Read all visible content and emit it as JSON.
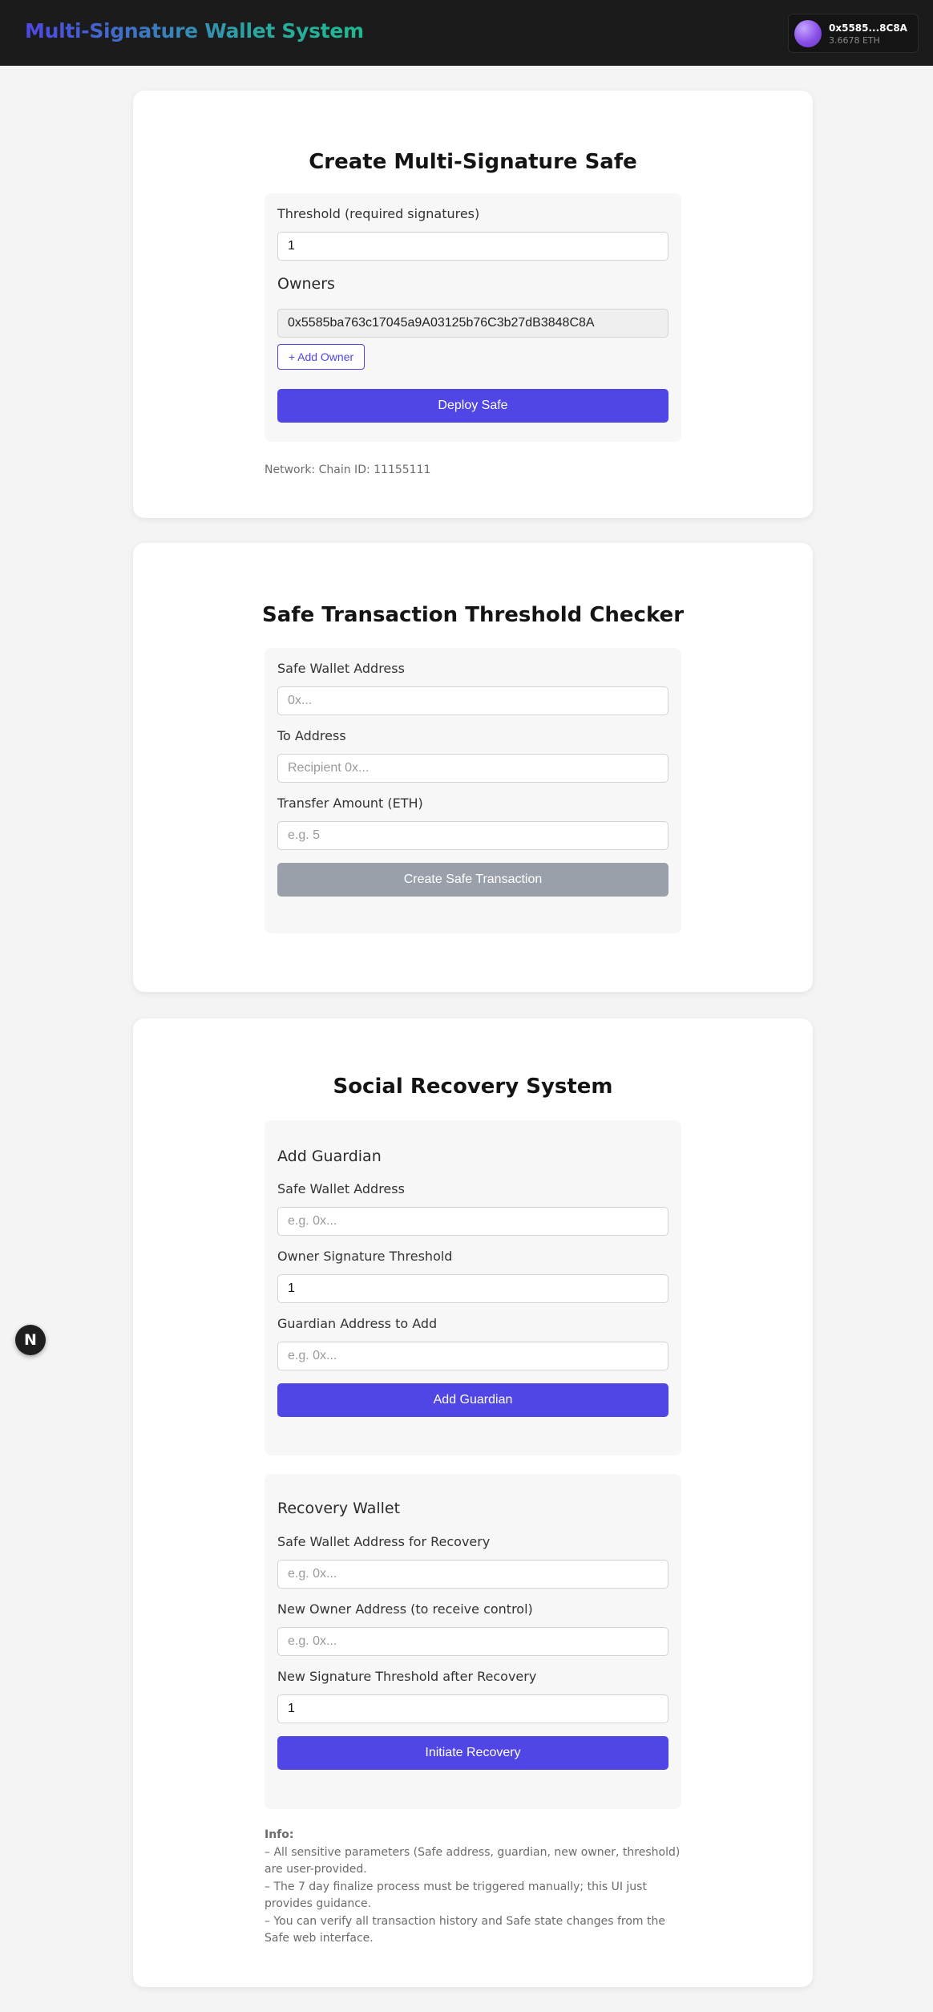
{
  "header": {
    "app_title": "Multi-Signature Wallet System",
    "wallet": {
      "address": "0x5585...8C8A",
      "balance": "3.6678 ETH"
    }
  },
  "create_safe": {
    "title": "Create Multi-Signature Safe",
    "threshold_label": "Threshold (required signatures)",
    "threshold_value": "1",
    "owners_heading": "Owners",
    "owners": [
      "0x5585ba763c17045a9A03125b76C3b27dB3848C8A"
    ],
    "add_owner_label": "+ Add Owner",
    "deploy_label": "Deploy Safe",
    "network_text": "Network: Chain ID: 11155111"
  },
  "threshold_checker": {
    "title": "Safe Transaction Threshold Checker",
    "safe_address_label": "Safe Wallet Address",
    "safe_address_placeholder": "0x...",
    "to_address_label": "To Address",
    "to_address_placeholder": "Recipient 0x...",
    "amount_label": "Transfer Amount (ETH)",
    "amount_placeholder": "e.g. 5",
    "create_tx_label": "Create Safe Transaction"
  },
  "social_recovery": {
    "title": "Social Recovery System",
    "add_guardian": {
      "heading": "Add Guardian",
      "safe_address_label": "Safe Wallet Address",
      "safe_address_placeholder": "e.g. 0x...",
      "threshold_label": "Owner Signature Threshold",
      "threshold_value": "1",
      "guardian_label": "Guardian Address to Add",
      "guardian_placeholder": "e.g. 0x...",
      "button_label": "Add Guardian"
    },
    "recovery": {
      "heading": "Recovery Wallet",
      "safe_address_label": "Safe Wallet Address for Recovery",
      "safe_address_placeholder": "e.g. 0x...",
      "new_owner_label": "New Owner Address (to receive control)",
      "new_owner_placeholder": "e.g. 0x...",
      "new_threshold_label": "New Signature Threshold after Recovery",
      "new_threshold_value": "1",
      "button_label": "Initiate Recovery"
    },
    "info": {
      "heading": "Info:",
      "lines": [
        "– All sensitive parameters (Safe address, guardian, new owner, threshold) are user-provided.",
        "– The 7 day finalize process must be triggered manually; this UI just provides guidance.",
        "– You can verify all transaction history and Safe state changes from the Safe web interface."
      ]
    }
  },
  "dev_badge": {
    "letter": "N"
  }
}
